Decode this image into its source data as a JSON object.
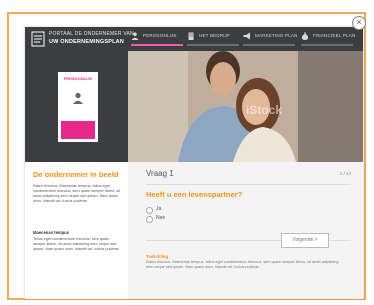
{
  "header": {
    "logo_line1": "PORTAAL DE ONDERNEMER VAN",
    "logo_line2": "UW ONDERNEMINGSPLAN",
    "steps": [
      {
        "label": "PERSOONLIJK",
        "active": true
      },
      {
        "label": "HET BEDRIJF",
        "active": false
      },
      {
        "label": "MARKETING PLAN",
        "active": false
      },
      {
        "label": "FINANCIEEL PLAN",
        "active": false
      }
    ],
    "close_label": "×"
  },
  "id_card": {
    "title": "PERSOONLIJK"
  },
  "sidebar": {
    "heading": "De ondernemer in beeld",
    "paragraph1": "Etiam rhoncus. Maecenas tempus, tellus eget condimentum rhoncus, sem quam semper libero, sit amet adipiscing sem neque sed ipsum. Nam quam nunc, blandit vel, luctus pulvinar.",
    "subheading": "Maecenas tempus",
    "paragraph2": "Tellus eget condimentum rhoncus, sem quam semper libero, sit amet adipiscing sem neque sed ipsum. Nam quam nunc, blandit vel, luctus pulvinar."
  },
  "question": {
    "title": "Vraag 1",
    "counter": "1 / 14",
    "text": "Heeft u een levenspartner?",
    "options": [
      "Ja",
      "Nee"
    ],
    "next_label": "Volgende >",
    "explain_heading": "Toelichting",
    "explain_text": "Etiam rhoncus. Maecenas tempus, tellus eget condimentum rhoncus, sem quam semper libero, sit amet adipiscing sem neque sed ipsum. Nam quam nunc, blandit vel, luctus pulvinar."
  },
  "hero": {
    "watermark": "iStock"
  },
  "colors": {
    "accent_orange": "#f2911b",
    "accent_pink": "#e8298b",
    "header_dark": "#3b3d40"
  }
}
